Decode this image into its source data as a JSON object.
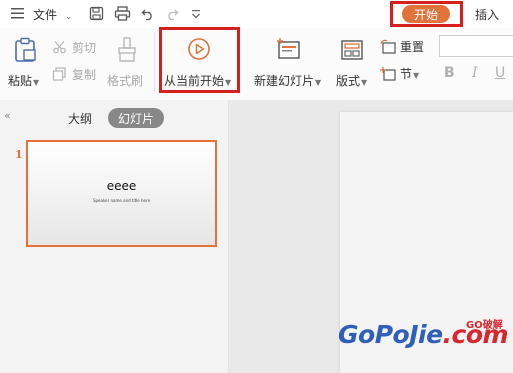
{
  "menubar": {
    "file_label": "文件",
    "tabs": [
      {
        "label": "开始",
        "active": true
      },
      {
        "label": "插入",
        "active": false
      }
    ]
  },
  "ribbon": {
    "paste": "粘贴",
    "cut": "剪切",
    "copy": "复制",
    "format_painter": "格式刷",
    "from_current": "从当前开始",
    "new_slide": "新建幻灯片",
    "layout": "版式",
    "reset": "重置",
    "section": "节",
    "bold": "B",
    "italic": "I",
    "underline": "U"
  },
  "panel": {
    "tabs": [
      {
        "label": "大纲",
        "active": false
      },
      {
        "label": "幻灯片",
        "active": true
      }
    ],
    "slides": [
      {
        "number": "1",
        "title": "eeee",
        "subtitle": "Speaker name and title here"
      }
    ]
  },
  "watermark": {
    "main": "GoPoJie",
    "suffix": ".com",
    "badge": "GO破解"
  },
  "colors": {
    "accent": "#e0733a",
    "highlight_red": "#d61f1f",
    "watermark_blue": "#2f5fb8",
    "watermark_red": "#d8262f"
  }
}
